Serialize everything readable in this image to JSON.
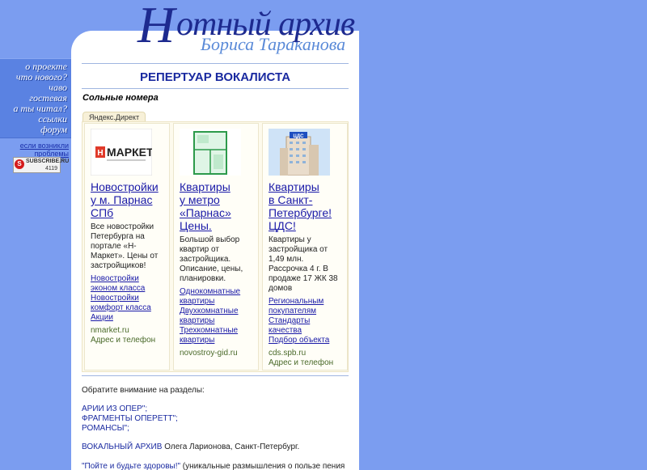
{
  "logo": {
    "line1_initial": "Н",
    "line1_rest": "отный архив",
    "line2": "Бориса Тараканова"
  },
  "nav": {
    "items": [
      "о проекте",
      "что нового?",
      "чаво",
      "гостевая",
      "а ты читал?",
      "ссылки",
      "форум"
    ],
    "note": "если возникли проблемы"
  },
  "subscribe": {
    "badge": "S",
    "label": "SUBSCRIBE.RU",
    "count": "4119"
  },
  "page": {
    "title": "РЕПЕРТУАР ВОКАЛИСТА",
    "subtitle": "Сольные номера"
  },
  "ads": {
    "tab": "Яндекс.Директ",
    "cards": [
      {
        "logo_text": "МАРКЕТ",
        "title_lines": [
          "Новостройки",
          "у м. Парнас",
          "СПб"
        ],
        "desc_lines": [
          "Все новостройки",
          "Петербурга на",
          "портале «Н-",
          "Маркет». Цены от",
          "застройщиков!"
        ],
        "links": [
          "Новостройки",
          "эконом класса",
          "Новостройки",
          "комфорт класса",
          "Акции"
        ],
        "domain": "nmarket.ru",
        "contact": "Адрес и телефон"
      },
      {
        "title_lines": [
          "Квартиры",
          "у метро",
          "«Парнас»",
          "Цены."
        ],
        "desc_lines": [
          "Большой выбор",
          "квартир от",
          "застройщика.",
          "Описание, цены,",
          "планировки."
        ],
        "links": [
          "Однокомнатные",
          "квартиры",
          "Двухкомнатные",
          "квартиры",
          "Трехкомнатные",
          "квартиры"
        ],
        "domain": "novostroy-gid.ru"
      },
      {
        "logo_text": "ЦДС",
        "title_lines": [
          "Квартиры",
          "в Санкт-",
          "Петербурге!",
          "ЦДС!"
        ],
        "desc_lines": [
          "Квартиры у",
          "застройщика от",
          "1,49 млн.",
          "Рассрочка 4 г. В",
          "продаже 17 ЖК 38",
          "домов"
        ],
        "links": [
          "Региональным",
          "покупателям",
          "Стандарты",
          "качества",
          "Подбор объекта"
        ],
        "domain": "cds.spb.ru",
        "contact": "Адрес и телефон"
      }
    ]
  },
  "sections": {
    "intro": "Обратите внимание на разделы:",
    "link1": "АРИИ ИЗ ОПЕР\";",
    "link2": "ФРАГМЕНТЫ ОПЕРЕТТ\";",
    "link3": "РОМАНСЫ\";",
    "archive_link": "ВОКАЛЬНЫЙ АРХИВ",
    "archive_text": " Олега Ларионова, Санкт-Петербург.",
    "quote_link": "\"Пойте и будьте здоровы!\"",
    "quote_text": " (уникальные размышления о пользе пения"
  },
  "colors": {
    "page_bg": "#7b9df0",
    "nav_band": "#5a82e2",
    "title": "#1a2aa0",
    "link": "#1a1aa8",
    "ad_domain": "#4a6a2a"
  }
}
